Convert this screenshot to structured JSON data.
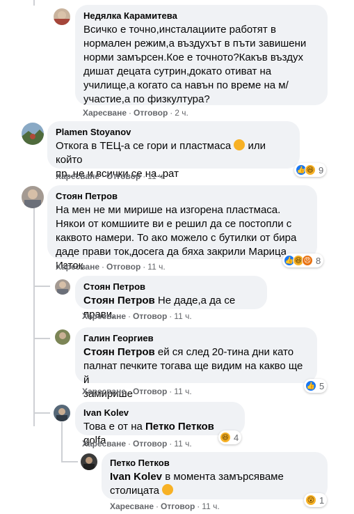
{
  "labels": {
    "like": "Харесване",
    "reply": "Отговор",
    "sep": "·"
  },
  "comments": [
    {
      "author": "Недялка Карамитева",
      "text": "Всичко е точно,инсталациите работят в нормален режим,а въздухът в пъти завишени норми замърсен.Кое е точното?Какъв въздух дишат децата сутрин,докато отиват на училище,а когато са навън по време на м/участие,а по физкултура?",
      "time": "2 ч.",
      "avatar_color": "#b9a38a"
    },
    {
      "author": "Plamen Stoyanov",
      "text_line1": "Откога в ТЕЦ-а се гори и пластмаса",
      "text_line1b": "или който",
      "text_line2": "пр..не и всички се на..рат",
      "emoji": "thinking-emoji",
      "time": "11 ч.",
      "reaction_count": "9",
      "avatar_color": "#5d7b8c"
    },
    {
      "author": "Стоян Петров",
      "text": "На мен не ми мирише на изгорена пластмаса. Някои от комшиите ви е решил да се постопли с каквото намери. То ако можело с бутилки от бира даде прави ток,досега да бяха закрили Марица Изток.",
      "time": "11 ч.",
      "reaction_count": "8",
      "avatar_color": "#8a7f7a"
    },
    {
      "author": "Стоян Петров",
      "mention": "Стоян Петров",
      "text": "Не даде,а да се прави.",
      "time": "11 ч.",
      "avatar_color": "#8a7f7a"
    },
    {
      "author": "Галин Георгиев",
      "mention": "Стоян Петров",
      "text_a": "ей ся след 20-тина дни като",
      "text_b": "палнат печките тогава ще видим на какво ще й",
      "text_c": "замирише",
      "time": "11 ч.",
      "reaction_count": "5",
      "avatar_color": "#6f7d4c"
    },
    {
      "author": "Ivan Kolev",
      "text_pre": "Това е от на",
      "mention": "Петко Петков",
      "text_post": "golfa",
      "time": "11 ч.",
      "reaction_count": "4",
      "avatar_color": "#4d5d6b"
    },
    {
      "author": "Петко Петков",
      "mention": "Ivan Kolev",
      "text_a": "в момента замърсяваме",
      "text_b": "столицата",
      "emoji": "grinning-emoji",
      "time": "11 ч.",
      "reaction_count": "1",
      "avatar_color": "#3b3b3b"
    }
  ]
}
